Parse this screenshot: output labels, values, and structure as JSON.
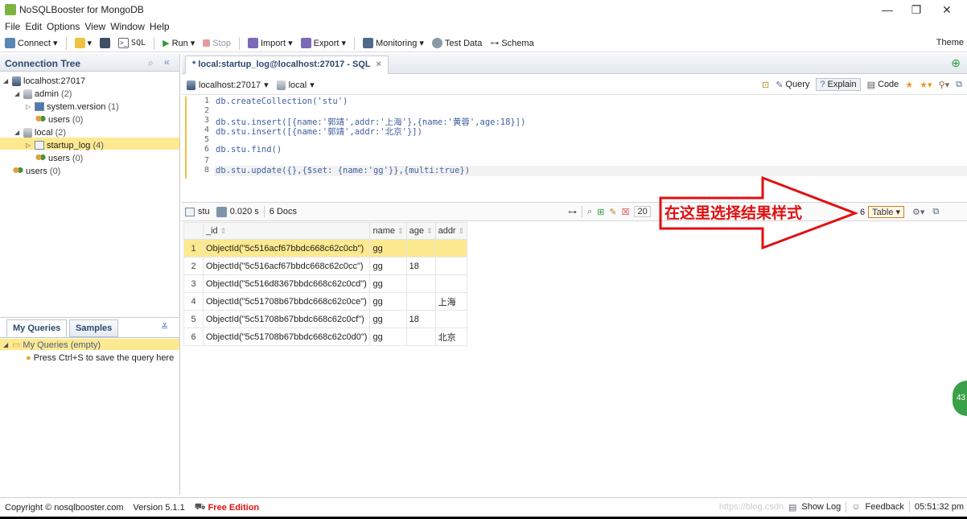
{
  "window": {
    "title": "NoSQLBooster for MongoDB",
    "minimize": "—",
    "restore": "❐",
    "close": "✕"
  },
  "menu": [
    "File",
    "Edit",
    "Options",
    "View",
    "Window",
    "Help"
  ],
  "toolbar": {
    "connect": "Connect",
    "sql": "SQL",
    "run": "Run",
    "stop": "Stop",
    "import": "Import",
    "export": "Export",
    "monitoring": "Monitoring",
    "test_data": "Test Data",
    "schema": "Schema",
    "theme": "Theme"
  },
  "connection_tree": {
    "header": "Connection Tree",
    "items": [
      {
        "label": "localhost:27017",
        "count": ""
      },
      {
        "label": "admin",
        "count": "(2)"
      },
      {
        "label": "system.version",
        "count": "(1)"
      },
      {
        "label": "users",
        "count": "(0)"
      },
      {
        "label": "local",
        "count": "(2)"
      },
      {
        "label": "startup_log",
        "count": "(4)"
      },
      {
        "label": "users",
        "count": "(0)"
      },
      {
        "label": "users",
        "count": "(0)"
      }
    ]
  },
  "queries": {
    "tab_my": "My Queries",
    "tab_samples": "Samples",
    "folder": "My Queries (empty)",
    "hint": "Press Ctrl+S to save the query here"
  },
  "main_tab": {
    "label": "* local:startup_log@localhost:27017 - SQL",
    "close": "×"
  },
  "context": {
    "server": "localhost:27017",
    "db": "local",
    "query": "Query",
    "explain": "Explain",
    "code": "Code"
  },
  "editor": {
    "lines": [
      {
        "n": "1",
        "text": "db.createCollection('stu')"
      },
      {
        "n": "2",
        "text": ""
      },
      {
        "n": "3",
        "text": "db.stu.insert([{name:'郭靖',addr:'上海'},{name:'黄蓉',age:18}])"
      },
      {
        "n": "4",
        "text": "db.stu.insert([{name:'郭靖',addr:'北京'}])"
      },
      {
        "n": "5",
        "text": ""
      },
      {
        "n": "6",
        "text": "db.stu.find()"
      },
      {
        "n": "7",
        "text": ""
      },
      {
        "n": "8",
        "text": "db.stu.update({},{$set: {name:'gg'}},{multi:true})"
      }
    ]
  },
  "results": {
    "collection": "stu",
    "time": "0.020 s",
    "docs": "6 Docs",
    "page_size": "20",
    "page_count": "6",
    "view_mode": "Table",
    "columns": [
      "_id",
      "name",
      "age",
      "addr"
    ],
    "rows": [
      {
        "n": "1",
        "id": "ObjectId(\"5c516acf67bbdc668c62c0cb\")",
        "name": "gg",
        "age": "",
        "addr": ""
      },
      {
        "n": "2",
        "id": "ObjectId(\"5c516acf67bbdc668c62c0cc\")",
        "name": "gg",
        "age": "18",
        "addr": ""
      },
      {
        "n": "3",
        "id": "ObjectId(\"5c516d8367bbdc668c62c0cd\")",
        "name": "gg",
        "age": "",
        "addr": ""
      },
      {
        "n": "4",
        "id": "ObjectId(\"5c51708b67bbdc668c62c0ce\")",
        "name": "gg",
        "age": "",
        "addr": "上海"
      },
      {
        "n": "5",
        "id": "ObjectId(\"5c51708b67bbdc668c62c0cf\")",
        "name": "gg",
        "age": "18",
        "addr": ""
      },
      {
        "n": "6",
        "id": "ObjectId(\"5c51708b67bbdc668c62c0d0\")",
        "name": "gg",
        "age": "",
        "addr": "北京"
      }
    ]
  },
  "annotation": {
    "text": "在这里选择结果样式",
    "color": "#e01010"
  },
  "bubble": {
    "text": "43"
  },
  "status": {
    "copyright": "Copyright ©  nosqlbooster.com",
    "version": "Version 5.1.1",
    "edition": "Free Edition",
    "watermark": "https://blog.csdn",
    "show_log": "Show Log",
    "feedback": "Feedback",
    "time": "05:51:32 pm"
  },
  "colors": {
    "accent": "#2b4a6f",
    "selection": "#fde98f",
    "edition": "#e01010"
  }
}
